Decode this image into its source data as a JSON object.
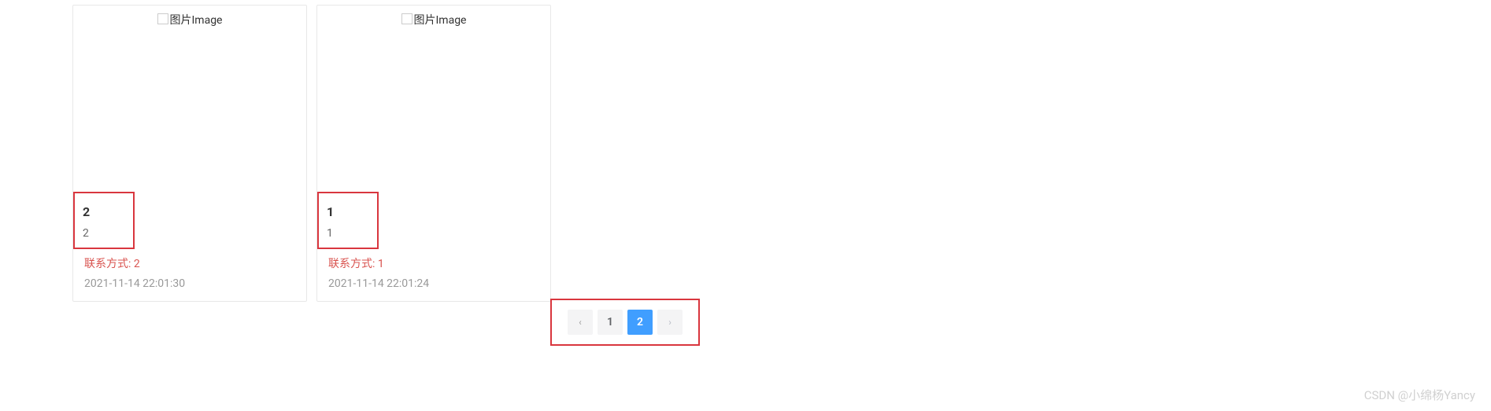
{
  "cards": [
    {
      "image_label": "图片Image",
      "title": "2",
      "subtitle": "2",
      "contact_label": "联系方式:",
      "contact_value": "2",
      "timestamp": "2021-11-14 22:01:30"
    },
    {
      "image_label": "图片Image",
      "title": "1",
      "subtitle": "1",
      "contact_label": "联系方式:",
      "contact_value": "1",
      "timestamp": "2021-11-14 22:01:24"
    }
  ],
  "pagination": {
    "prev": "‹",
    "next": "›",
    "pages": [
      "1",
      "2"
    ],
    "active": "2"
  },
  "watermark": "CSDN @小绵杨Yancy"
}
